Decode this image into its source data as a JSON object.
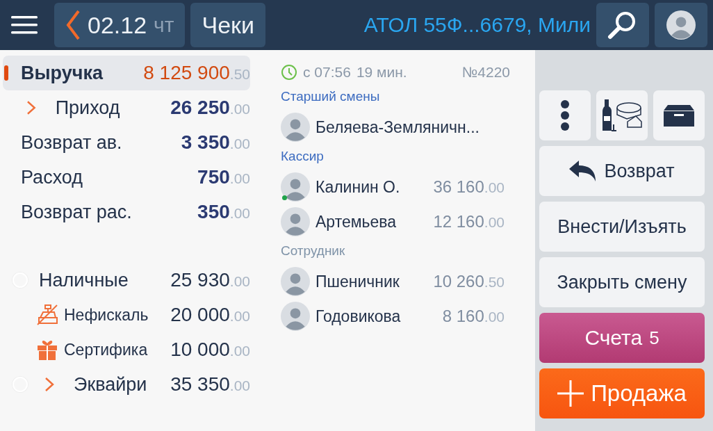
{
  "top_bar": {
    "date": "02.12",
    "weekday": "чт",
    "checks_button": "Чеки",
    "device": "АТОЛ 55Ф...6679, Мили"
  },
  "summary": [
    {
      "kind": "main",
      "label": "Выручка",
      "amount": "8 125 900",
      "cents": ".50",
      "selected": true
    },
    {
      "kind": "expandable",
      "label": "Приход",
      "amount": "26 250",
      "cents": ".00",
      "selected": false
    },
    {
      "kind": "plain",
      "label": "Возврат ав.",
      "amount": "3 350",
      "cents": ".00",
      "selected": false
    },
    {
      "kind": "plain",
      "label": "Расход",
      "amount": "750",
      "cents": ".00",
      "selected": false
    },
    {
      "kind": "plain",
      "label": "Возврат рас.",
      "amount": "350",
      "cents": ".00",
      "selected": false
    }
  ],
  "payments": [
    {
      "kind": "radio",
      "label": "Наличные",
      "amount": "25 930",
      "cents": ".00",
      "selected": false
    },
    {
      "kind": "sub",
      "label": "Нефискаль",
      "amount": "20 000",
      "cents": ".00"
    },
    {
      "kind": "sub",
      "label": "Сертифика",
      "amount": "10 000",
      "cents": ".00"
    },
    {
      "kind": "radio-expandable",
      "label": "Эквайри",
      "amount": "35 350",
      "cents": ".00",
      "selected": false
    }
  ],
  "shift": {
    "since": "с 07:56",
    "duration": "19 мин.",
    "number": "№4220",
    "groups": [
      {
        "title": "Старший смены",
        "highlighted": true,
        "members": [
          {
            "name": "Беляева-Земляничн...",
            "online": false
          }
        ]
      },
      {
        "title": "Кассир",
        "highlighted": true,
        "members": [
          {
            "name": "Калинин О.",
            "amount": "36 160",
            "cents": ".00",
            "online": true
          },
          {
            "name": "Артемьева",
            "amount": "12 160",
            "cents": ".00",
            "online": false
          }
        ]
      },
      {
        "title": "Сотрудник",
        "highlighted": false,
        "members": [
          {
            "name": "Пшеничник",
            "amount": "10 260",
            "cents": ".50",
            "online": false
          },
          {
            "name": "Годовикова",
            "amount": "8 160",
            "cents": ".00",
            "online": false
          }
        ]
      }
    ]
  },
  "actions": [
    {
      "kind": "return",
      "label": "Возврат"
    },
    {
      "kind": "plain",
      "label": "Внести/Изъять"
    },
    {
      "kind": "plain",
      "label": "Закрыть смену"
    },
    {
      "kind": "accounts",
      "label": "Счета",
      "count": "5"
    },
    {
      "kind": "sale",
      "label": "Продажа"
    }
  ]
}
